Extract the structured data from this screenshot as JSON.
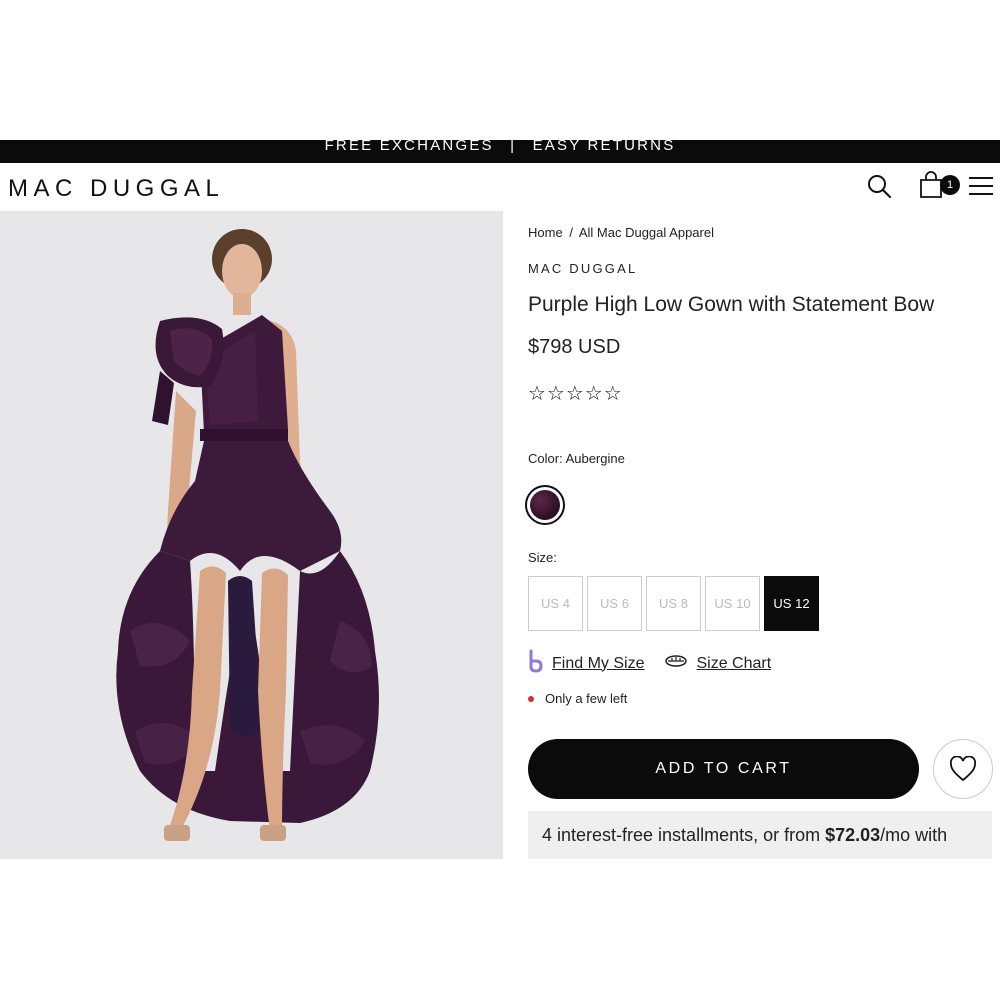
{
  "announcement": {
    "left": "FREE EXCHANGES",
    "separator": "|",
    "right": "EASY RETURNS"
  },
  "header": {
    "logo": "MAC DUGGAL",
    "cart_count": "1"
  },
  "breadcrumb": {
    "home": "Home",
    "separator": "/",
    "current": "All Mac Duggal Apparel"
  },
  "product": {
    "brand": "MAC DUGGAL",
    "title": "Purple High Low Gown with Statement Bow",
    "price": "$798 USD",
    "rating_stars": "☆☆☆☆☆",
    "color_label": "Color: Aubergine",
    "size_label": "Size:",
    "sizes": [
      "US 4",
      "US 6",
      "US 8",
      "US 10",
      "US 12"
    ],
    "selected_size": "US 12",
    "find_my_size": "Find My Size",
    "size_chart": "Size Chart",
    "stock": "Only a few left",
    "add_to_cart": "ADD TO CART",
    "installments": {
      "prefix": "4 interest-free installments, or from ",
      "amount": "$72.03",
      "suffix": "/mo with"
    }
  },
  "colors": {
    "accent": "#0b0b0b",
    "dress": "#3b1a3a",
    "stock_dot": "#d4322b",
    "image_bg": "#e7e7e9"
  },
  "icons": [
    "search-icon",
    "shopping-bag-icon",
    "hamburger-menu-icon",
    "star-outline-icon",
    "ruler-icon",
    "heart-icon"
  ]
}
